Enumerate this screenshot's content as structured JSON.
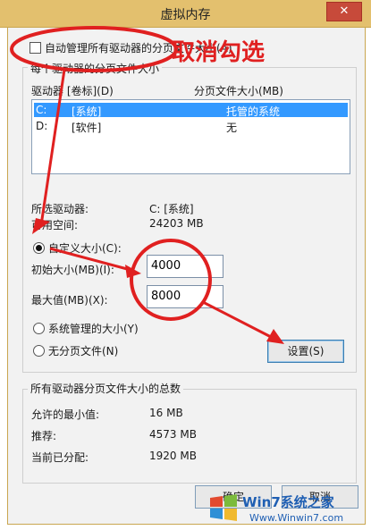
{
  "window": {
    "title": "虚拟内存",
    "close_label": "✕"
  },
  "auto_manage": {
    "label": "自动管理所有驱动器的分页文件大小(A)",
    "checked": false
  },
  "drives_group": {
    "legend": "每个驱动器的分页文件大小",
    "col_drive": "驱动器 [卷标](D)",
    "col_size": "分页文件大小(MB)",
    "rows": [
      {
        "drive": "C:",
        "label": "[系统]",
        "size": "托管的系统",
        "selected": true
      },
      {
        "drive": "D:",
        "label": "[软件]",
        "size": "无",
        "selected": false
      }
    ],
    "selected_drive_label": "所选驱动器:",
    "selected_drive_value": "C:  [系统]",
    "free_space_label": "可用空间:",
    "free_space_value": "24203 MB",
    "custom_size_label": "自定义大小(C):",
    "initial_size_label": "初始大小(MB)(I):",
    "initial_size_value": "4000",
    "max_size_label": "最大值(MB)(X):",
    "max_size_value": "8000",
    "system_managed_label": "系统管理的大小(Y)",
    "no_paging_label": "无分页文件(N)",
    "set_button": "设置(S)",
    "selected_option": "custom"
  },
  "totals_group": {
    "legend": "所有驱动器分页文件大小的总数",
    "min_label": "允许的最小值:",
    "min_value": "16 MB",
    "recommended_label": "推荐:",
    "recommended_value": "4573 MB",
    "current_label": "当前已分配:",
    "current_value": "1920 MB"
  },
  "footer": {
    "ok_label": "确定",
    "cancel_label": "取消"
  },
  "annotation": {
    "text": "取消勾选",
    "color": "#e02020"
  },
  "watermark": {
    "brand": "Win7系统之家",
    "url": "Www.Winwin7.com"
  }
}
